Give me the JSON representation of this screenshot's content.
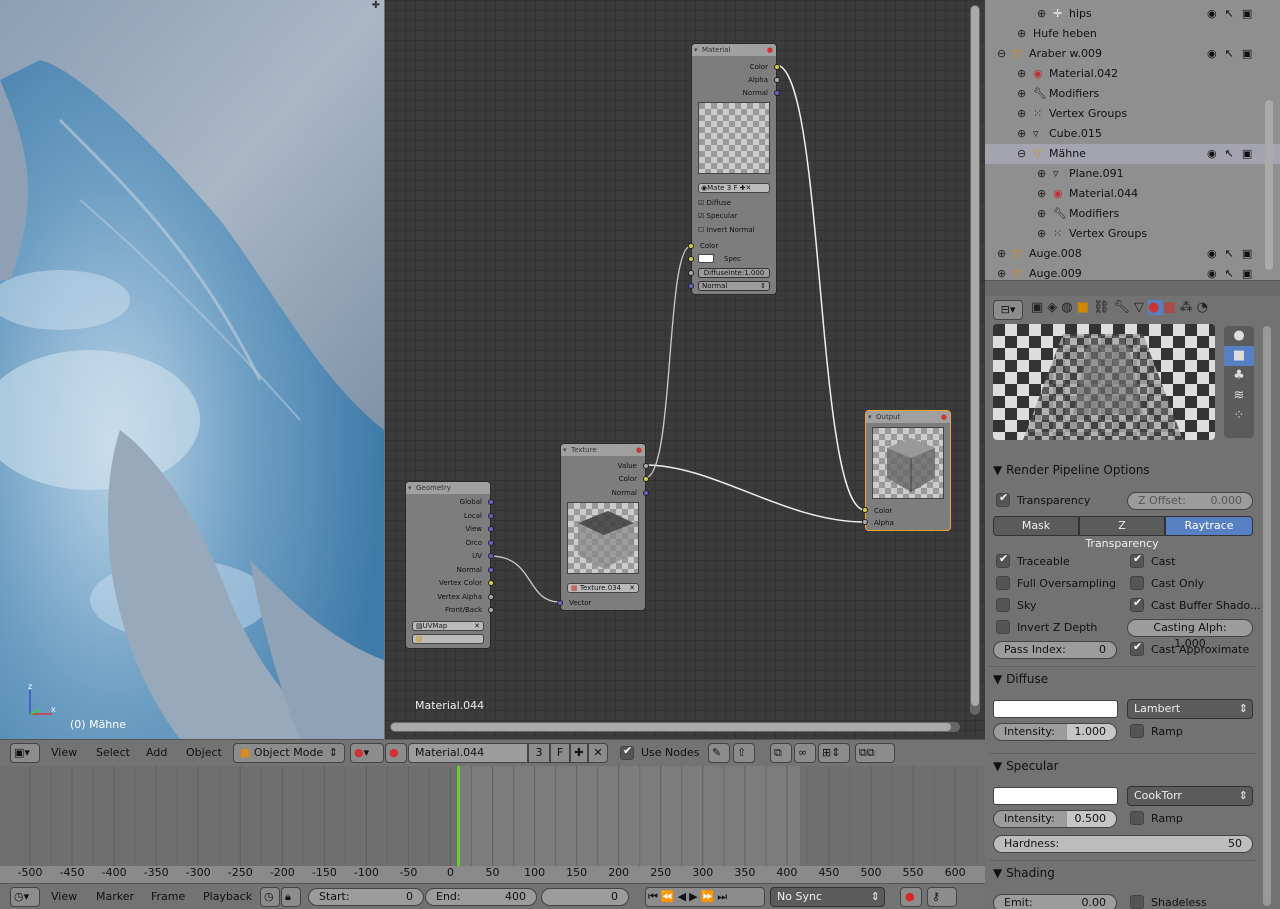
{
  "viewport": {
    "object_label": "(0) Mähne",
    "axis_x": "x",
    "axis_z": "z"
  },
  "viewport_header": {
    "menu": [
      "View",
      "Select",
      "Add",
      "Object"
    ],
    "mode": "Object Mode"
  },
  "node_editor": {
    "material_label": "Material.044",
    "nodes": {
      "material": {
        "title": "Material",
        "outputs": [
          "Color",
          "Alpha",
          "Normal"
        ],
        "mat_field": "Mate",
        "mat_users": "3",
        "mat_f": "F",
        "checks": [
          {
            "label": "Diffuse",
            "on": true
          },
          {
            "label": "Specular",
            "on": true
          },
          {
            "label": "Invert Normal",
            "on": false
          }
        ],
        "in_color": "Color",
        "in_spec": "Spec",
        "diffuse_intensity": "DiffuseInte:1.000",
        "normal": "Normal"
      },
      "texture": {
        "title": "Texture",
        "outputs": [
          "Value",
          "Color",
          "Normal"
        ],
        "tex_field": "Texture.034",
        "input": "Vector"
      },
      "geometry": {
        "title": "Geometry",
        "outputs": [
          "Global",
          "Local",
          "View",
          "Orco",
          "UV",
          "Normal",
          "Vertex Color",
          "Vertex Alpha",
          "Front/Back"
        ],
        "uvmap": "UVMap"
      },
      "output": {
        "title": "Output",
        "inputs": [
          "Color",
          "Alpha"
        ]
      }
    }
  },
  "node_header": {
    "material": "Material.044",
    "users": "3",
    "fake": "F",
    "use_nodes": "Use Nodes",
    "use_nodes_on": true
  },
  "timeline": {
    "ticks": [
      "-500",
      "-450",
      "-400",
      "-350",
      "-300",
      "-250",
      "-200",
      "-150",
      "-100",
      "-50",
      "0",
      "50",
      "100",
      "150",
      "200",
      "250",
      "300",
      "350",
      "400",
      "450",
      "500",
      "550",
      "600"
    ],
    "current_frame": 0
  },
  "timeline_header": {
    "menu": [
      "View",
      "Marker",
      "Frame",
      "Playback"
    ],
    "start_label": "Start:",
    "start": "0",
    "end_label": "End:",
    "end": "400",
    "frame": "0",
    "sync": "No Sync"
  },
  "outliner": {
    "rows": [
      {
        "indent": 2,
        "icon": "bone-icon",
        "label": "hips",
        "extra": "bones"
      },
      {
        "indent": 1,
        "icon": "none",
        "label": "Hufe heben"
      },
      {
        "indent": 0,
        "icon": "mesh-object-icon",
        "label": "Araber w.009"
      },
      {
        "indent": 1,
        "icon": "material-icon",
        "label": "Material.042"
      },
      {
        "indent": 1,
        "icon": "wrench-icon",
        "label": "Modifiers"
      },
      {
        "indent": 1,
        "icon": "vertex-groups-icon",
        "label": "Vertex Groups"
      },
      {
        "indent": 1,
        "icon": "mesh-data-icon",
        "label": "Cube.015"
      },
      {
        "indent": 1,
        "icon": "mesh-object-icon",
        "label": "Mähne"
      },
      {
        "indent": 2,
        "icon": "mesh-data-icon",
        "label": "Plane.091"
      },
      {
        "indent": 2,
        "icon": "material-icon",
        "label": "Material.044"
      },
      {
        "indent": 2,
        "icon": "wrench-icon",
        "label": "Modifiers"
      },
      {
        "indent": 2,
        "icon": "vertex-groups-icon",
        "label": "Vertex Groups"
      },
      {
        "indent": 0,
        "icon": "mesh-object-icon",
        "label": "Auge.008"
      },
      {
        "indent": 0,
        "icon": "mesh-object-icon",
        "label": "Auge.009"
      }
    ]
  },
  "properties": {
    "render_pipeline": {
      "title": "Render Pipeline Options",
      "transparency": "Transparency",
      "transparency_on": true,
      "z_offset_label": "Z Offset:",
      "z_offset": "0.000",
      "modes": [
        "Mask",
        "Z Transparency",
        "Raytrace"
      ],
      "active_mode": "Raytrace",
      "left_checks": [
        {
          "label": "Traceable",
          "on": true
        },
        {
          "label": "Full Oversampling",
          "on": false
        },
        {
          "label": "Sky",
          "on": false
        },
        {
          "label": "Invert Z Depth",
          "on": false
        }
      ],
      "right_checks": [
        {
          "label": "Cast",
          "on": true
        },
        {
          "label": "Cast Only",
          "on": false
        },
        {
          "label": "Cast Buffer Shado...",
          "on": true
        }
      ],
      "casting_alpha": "Casting Alph: 1.000",
      "pass_index_label": "Pass Index:",
      "pass_index": "0",
      "cast_approx": "Cast Approximate",
      "cast_approx_on": true
    },
    "diffuse": {
      "title": "Diffuse",
      "shader": "Lambert",
      "intensity_label": "Intensity:",
      "intensity": "1.000",
      "ramp": "Ramp"
    },
    "specular": {
      "title": "Specular",
      "shader": "CookTorr",
      "intensity_label": "Intensity:",
      "intensity": "0.500",
      "ramp": "Ramp",
      "hardness_label": "Hardness:",
      "hardness": "50"
    },
    "shading": {
      "title": "Shading",
      "emit_label": "Emit:",
      "emit": "0.00",
      "shadeless": "Shadeless"
    }
  },
  "colors": {
    "accent": "#5680c2",
    "frame_marker": "#66cc33",
    "selected_node": "#f3a32e"
  }
}
